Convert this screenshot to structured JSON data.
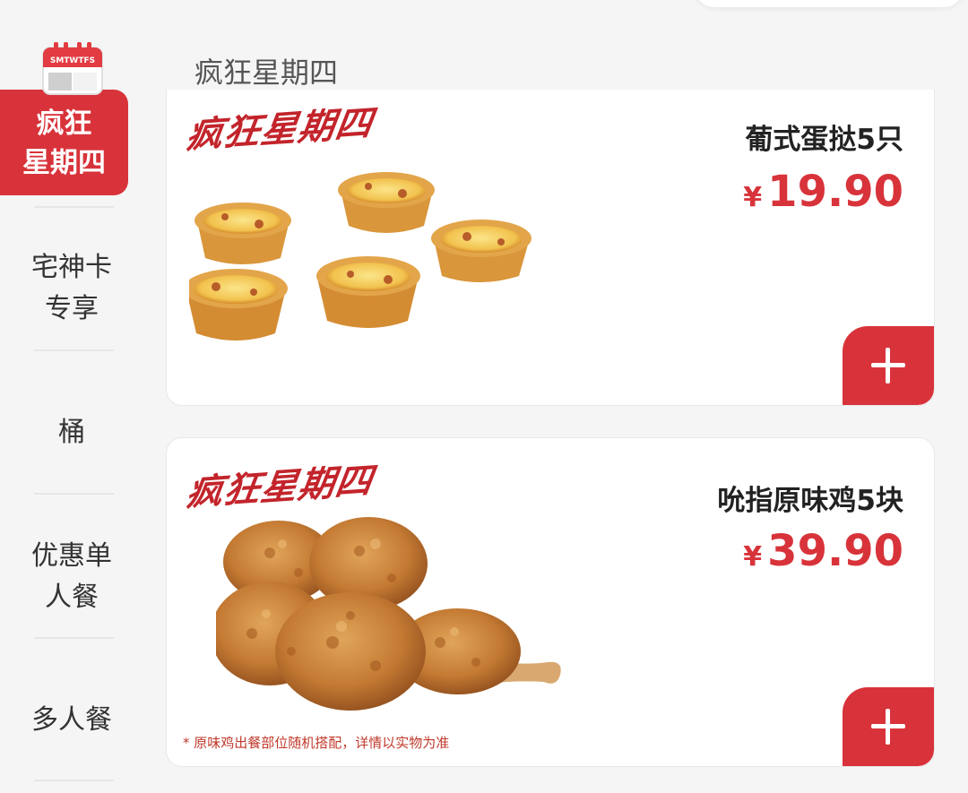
{
  "sidebar": {
    "items": [
      {
        "label_line1": "疯狂",
        "label_line2": "星期四",
        "active": true
      },
      {
        "label_line1": "宅神卡",
        "label_line2": "专享"
      },
      {
        "label_line1": "桶",
        "label_line2": ""
      },
      {
        "label_line1": "优惠单",
        "label_line2": "人餐"
      },
      {
        "label_line1": "多人餐",
        "label_line2": ""
      }
    ],
    "calendar_letters": "SMTWTFS"
  },
  "section": {
    "title": "疯狂星期四"
  },
  "products": [
    {
      "promo": "疯狂星期四",
      "name": "葡式蛋挞5只",
      "currency": "¥",
      "price": "19.90",
      "icon": "egg-tarts-image"
    },
    {
      "promo": "疯狂星期四",
      "name": "吮指原味鸡5块",
      "currency": "¥",
      "price": "39.90",
      "note": "* 原味鸡出餐部位随机搭配，详情以实物为准",
      "icon": "fried-chicken-image"
    }
  ],
  "colors": {
    "accent": "#d8333a",
    "background": "#f5f5f5",
    "card": "#ffffff"
  }
}
